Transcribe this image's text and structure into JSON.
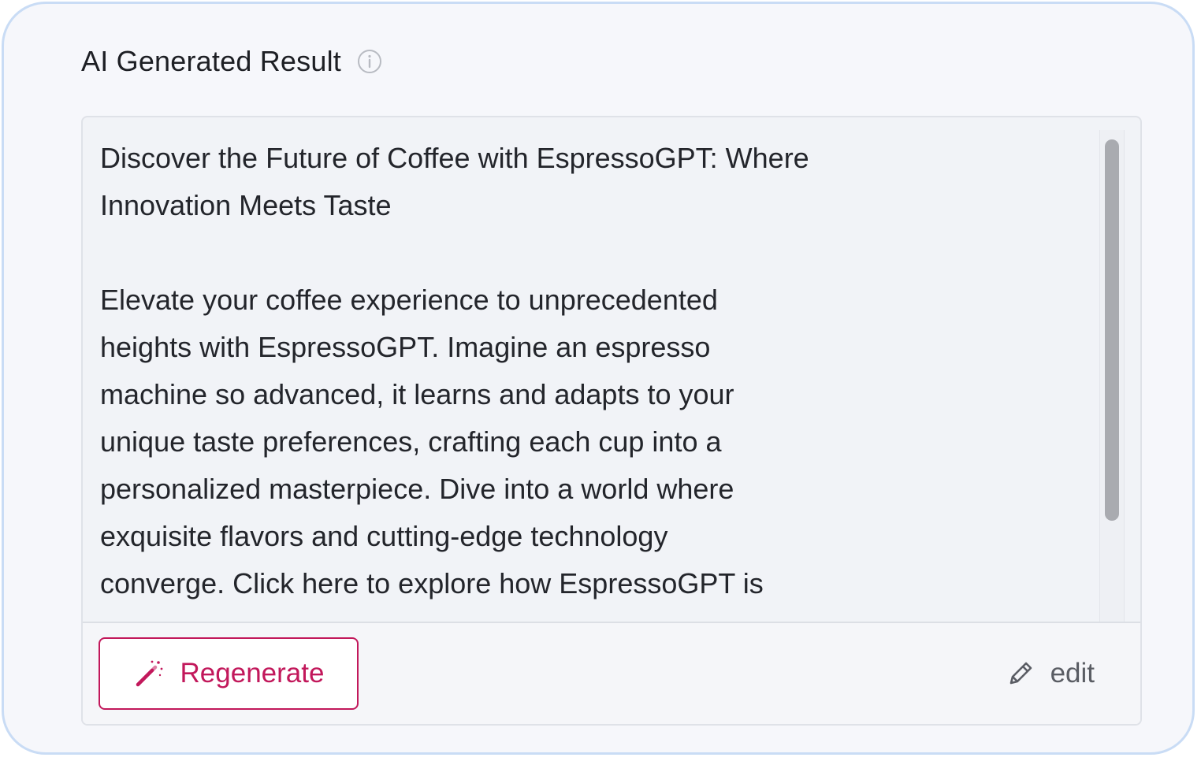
{
  "header": {
    "title": "AI Generated Result",
    "info_icon": "info-circle-icon"
  },
  "result": {
    "text": "Discover the Future of Coffee with EspressoGPT: Where\nInnovation Meets Taste\n\nElevate your coffee experience to unprecedented\nheights with EspressoGPT. Imagine an espresso\nmachine so advanced, it learns and adapts to your\nunique taste preferences, crafting each cup into a\npersonalized masterpiece. Dive into a world where\nexquisite flavors and cutting-edge technology\nconverge. Click here to explore how EspressoGPT is"
  },
  "actions": {
    "regenerate_label": "Regenerate",
    "regenerate_icon": "magic-wand-icon",
    "edit_label": "edit",
    "edit_icon": "pencil-icon"
  },
  "colors": {
    "accent": "#c2185b",
    "border": "#c9dcf5",
    "panel_bg": "#f1f3f7"
  }
}
